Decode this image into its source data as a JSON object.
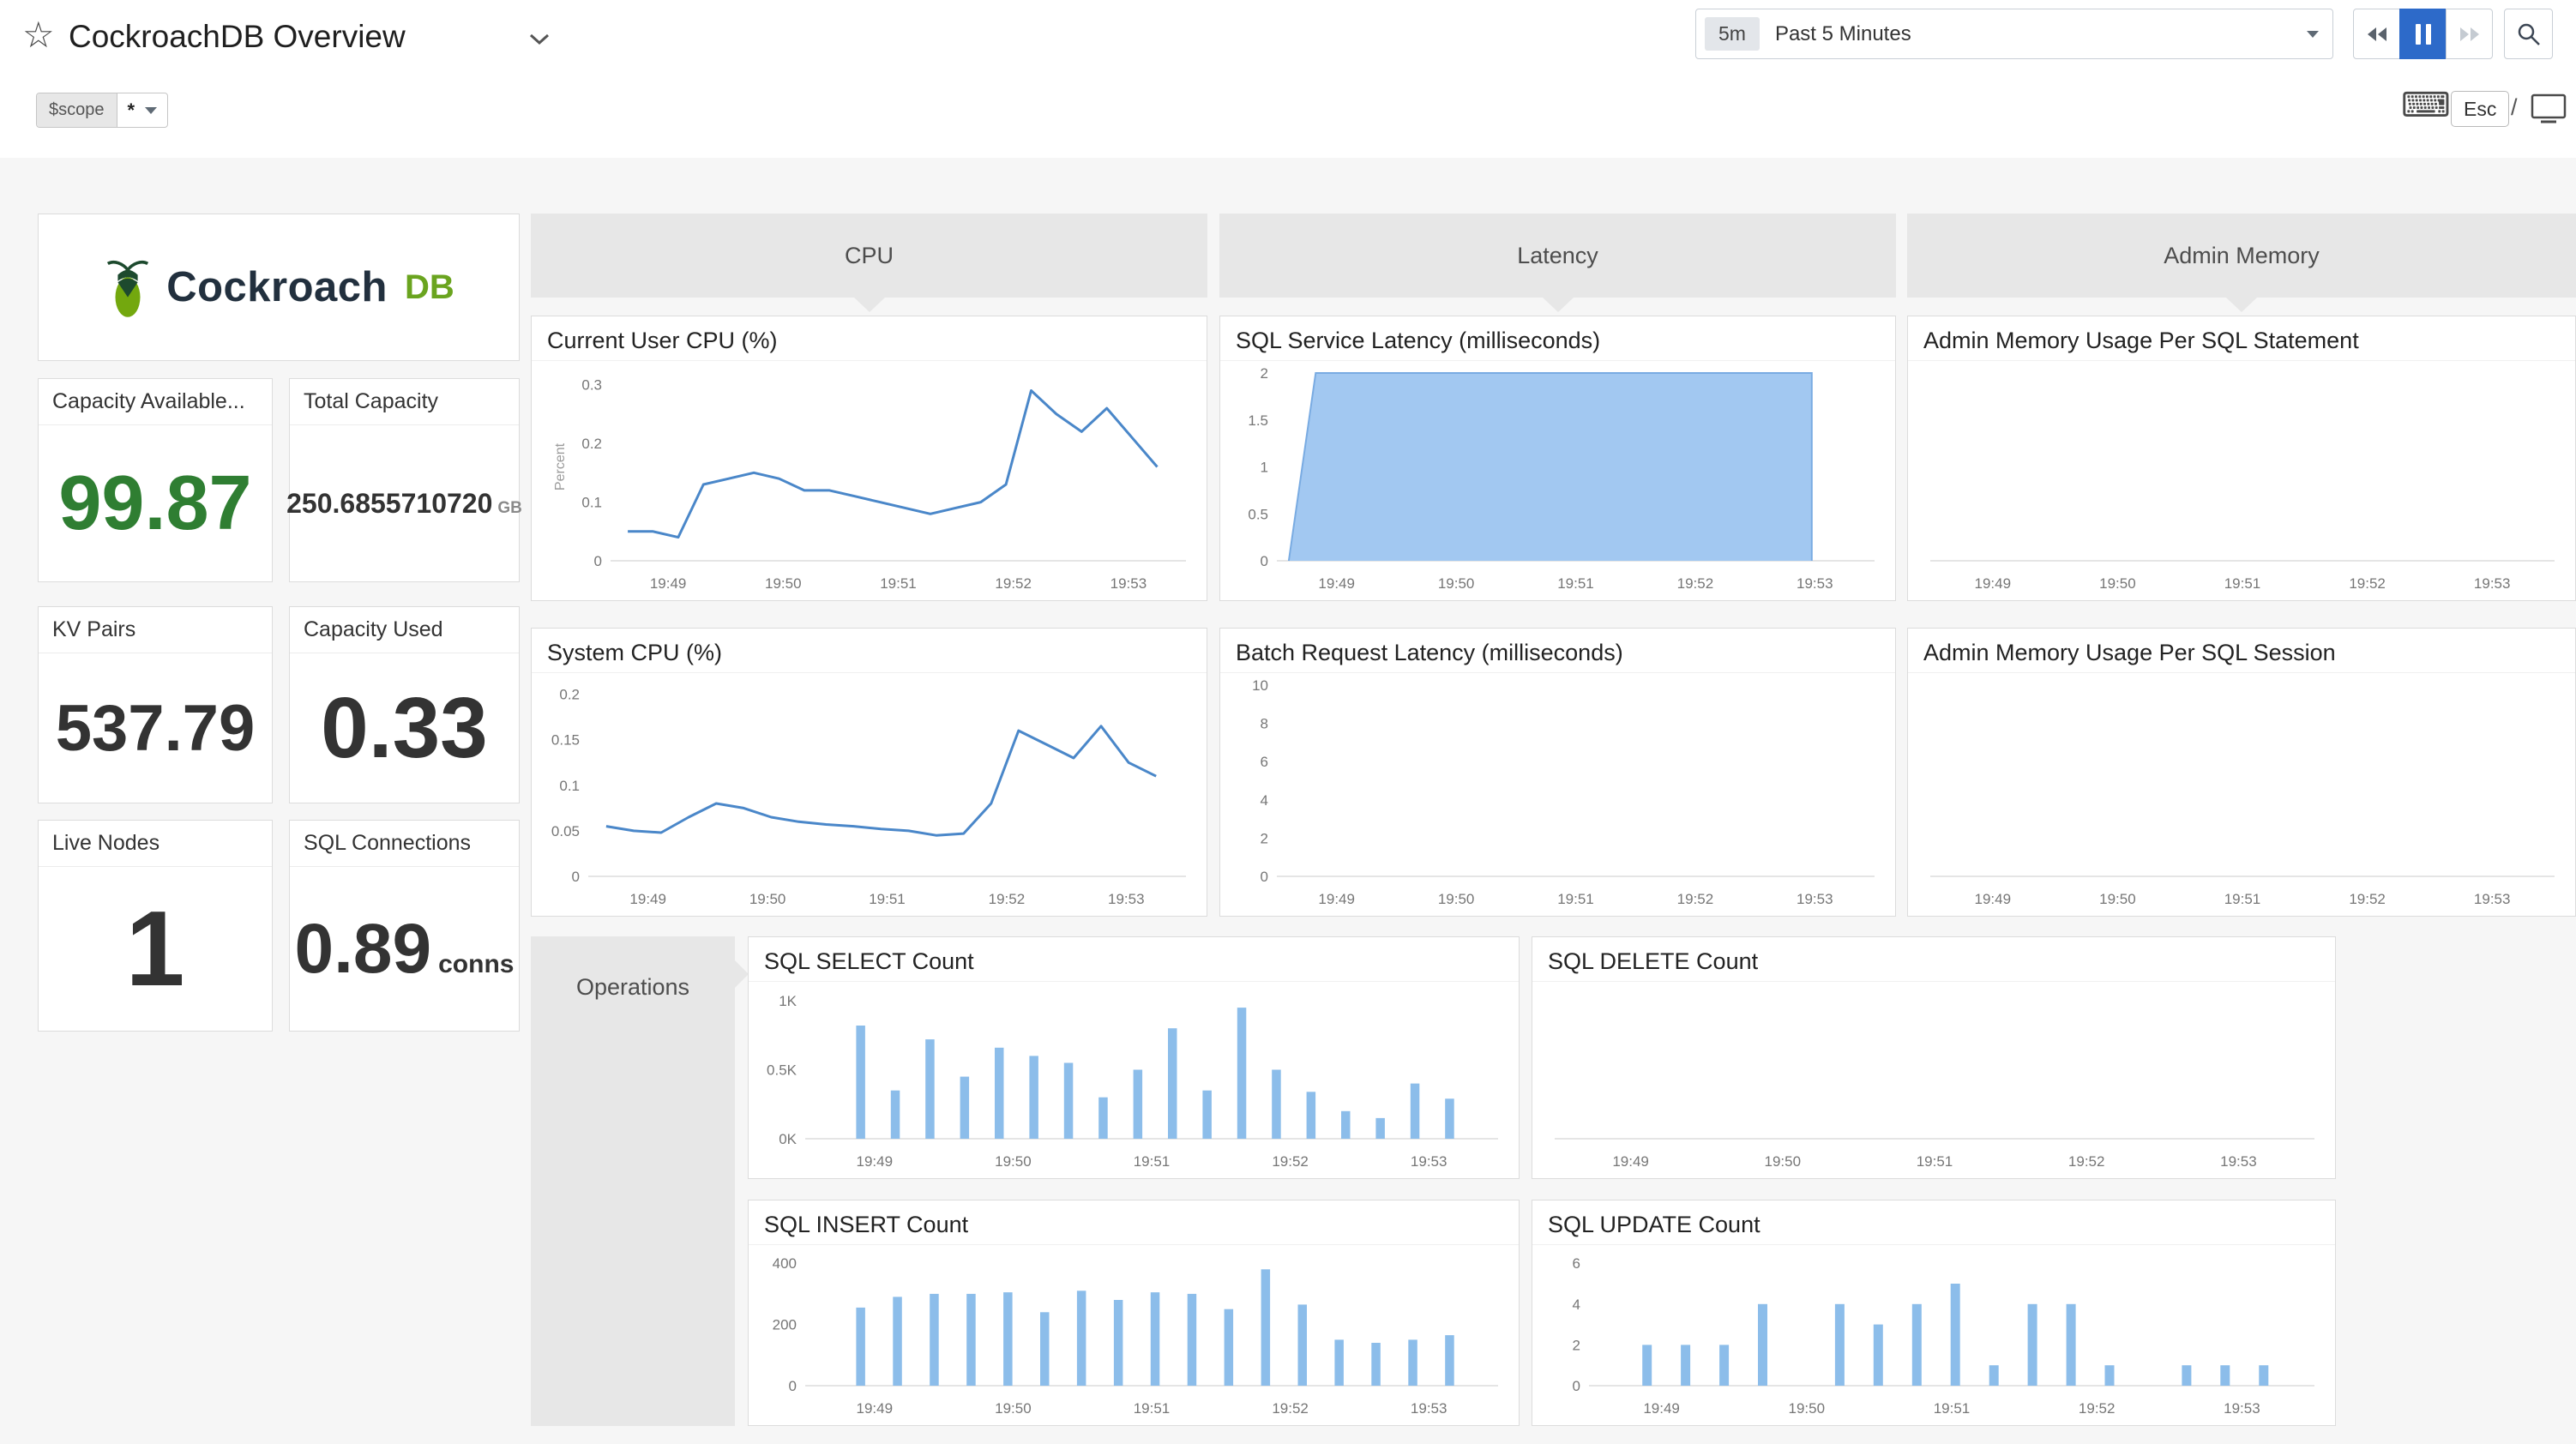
{
  "header": {
    "title": "CockroachDB Overview",
    "time_range": {
      "badge": "5m",
      "label": "Past 5 Minutes"
    },
    "shortcuts": {
      "esc": "Esc",
      "slash": "/"
    }
  },
  "icons": {
    "star": "☆",
    "keyboard": "⌨"
  },
  "scope_bar": {
    "variable": "$scope",
    "value": "*"
  },
  "logo": {
    "name": "Cockroach",
    "suffix": "DB"
  },
  "query_values": [
    {
      "title": "Capacity Available...",
      "value": "99.87",
      "unit": ""
    },
    {
      "title": "Total Capacity",
      "value": "250.6855710720",
      "unit": "GB"
    },
    {
      "title": "KV Pairs",
      "value": "537.79",
      "unit": ""
    },
    {
      "title": "Capacity Used",
      "value": "0.33",
      "unit": ""
    },
    {
      "title": "Live Nodes",
      "value": "1",
      "unit": ""
    },
    {
      "title": "SQL Connections",
      "value": "0.89",
      "unit": "conns"
    }
  ],
  "groups": [
    {
      "label": "CPU"
    },
    {
      "label": "Latency"
    },
    {
      "label": "Admin Memory"
    },
    {
      "label": "Operations"
    }
  ],
  "colors": {
    "accent_blue": "#2d6ac9",
    "line": "#4a87c9",
    "bar": "#8cbdea",
    "area_fill": "#a2c8f1",
    "area_stroke": "#79abe2",
    "value_green": "#2f7e32",
    "group_gray": "#e7e7e7"
  },
  "chart_data": [
    {
      "id": "current-user-cpu",
      "title": "Current User CPU (%)",
      "type": "line",
      "ylabel": "Percent",
      "ylim": [
        0,
        0.32
      ],
      "y_tick_values": [
        0,
        0.1,
        0.2,
        0.3
      ],
      "y_tick_labels": [
        "0",
        "0.1",
        "0.2",
        "0.3"
      ],
      "x_ticks": [
        "19:49",
        "19:50",
        "19:51",
        "19:52",
        "19:53"
      ],
      "values": [
        0.05,
        0.05,
        0.04,
        0.13,
        0.14,
        0.15,
        0.14,
        0.12,
        0.12,
        0.11,
        0.1,
        0.09,
        0.08,
        0.09,
        0.1,
        0.13,
        0.29,
        0.25,
        0.22,
        0.26,
        0.21,
        0.16
      ]
    },
    {
      "id": "system-cpu",
      "title": "System CPU (%)",
      "type": "line",
      "ylim": [
        0,
        0.21
      ],
      "y_tick_values": [
        0,
        0.05,
        0.1,
        0.15,
        0.2
      ],
      "y_tick_labels": [
        "0",
        "0.05",
        "0.1",
        "0.15",
        "0.2"
      ],
      "x_ticks": [
        "19:49",
        "19:50",
        "19:51",
        "19:52",
        "19:53"
      ],
      "values": [
        0.055,
        0.05,
        0.048,
        0.065,
        0.08,
        0.075,
        0.065,
        0.06,
        0.057,
        0.055,
        0.052,
        0.05,
        0.045,
        0.047,
        0.08,
        0.16,
        0.145,
        0.13,
        0.165,
        0.125,
        0.11
      ]
    },
    {
      "id": "sql-service-latency",
      "title": "SQL Service Latency (milliseconds)",
      "type": "area",
      "ylim": [
        0,
        2
      ],
      "y_tick_values": [
        0,
        0.5,
        1,
        1.5,
        2
      ],
      "y_tick_labels": [
        "0",
        "0.5",
        "1",
        "1.5",
        "2"
      ],
      "x_ticks": [
        "19:49",
        "19:50",
        "19:51",
        "19:52",
        "19:53"
      ],
      "points": [
        [
          0.02,
          0
        ],
        [
          0.065,
          2
        ],
        [
          0.895,
          2
        ]
      ]
    },
    {
      "id": "batch-request-latency",
      "title": "Batch Request Latency (milliseconds)",
      "type": "empty",
      "ylim": [
        0,
        10
      ],
      "y_tick_values": [
        0,
        2,
        4,
        6,
        8,
        10
      ],
      "y_tick_labels": [
        "0",
        "2",
        "4",
        "6",
        "8",
        "10"
      ],
      "x_ticks": [
        "19:49",
        "19:50",
        "19:51",
        "19:52",
        "19:53"
      ]
    },
    {
      "id": "admin-memory-per-statement",
      "title": "Admin Memory Usage Per SQL Statement",
      "type": "empty",
      "x_ticks": [
        "19:49",
        "19:50",
        "19:51",
        "19:52",
        "19:53"
      ]
    },
    {
      "id": "admin-memory-per-session",
      "title": "Admin Memory Usage Per SQL Session",
      "type": "empty",
      "x_ticks": [
        "19:49",
        "19:50",
        "19:51",
        "19:52",
        "19:53"
      ]
    },
    {
      "id": "sql-select-count",
      "title": "SQL SELECT Count",
      "type": "bar",
      "ylim": [
        0,
        1050
      ],
      "y_tick_values": [
        0,
        500,
        1000
      ],
      "y_tick_labels": [
        "0K",
        "0.5K",
        "1K"
      ],
      "x_ticks": [
        "19:49",
        "19:50",
        "19:51",
        "19:52",
        "19:53"
      ],
      "values": [
        820,
        350,
        720,
        450,
        660,
        600,
        550,
        300,
        500,
        800,
        350,
        950,
        500,
        340,
        200,
        150,
        400,
        290
      ]
    },
    {
      "id": "sql-delete-count",
      "title": "SQL DELETE Count",
      "type": "empty",
      "x_ticks": [
        "19:49",
        "19:50",
        "19:51",
        "19:52",
        "19:53"
      ]
    },
    {
      "id": "sql-insert-count",
      "title": "SQL INSERT Count",
      "type": "bar",
      "ylim": [
        0,
        420
      ],
      "y_tick_values": [
        0,
        200,
        400
      ],
      "y_tick_labels": [
        "0",
        "200",
        "400"
      ],
      "x_ticks": [
        "19:49",
        "19:50",
        "19:51",
        "19:52",
        "19:53"
      ],
      "values": [
        255,
        290,
        300,
        300,
        305,
        240,
        310,
        280,
        305,
        300,
        250,
        380,
        265,
        150,
        140,
        150,
        165
      ]
    },
    {
      "id": "sql-update-count",
      "title": "SQL UPDATE Count",
      "type": "bar",
      "ylim": [
        0,
        6.3
      ],
      "y_tick_values": [
        0,
        2,
        4,
        6
      ],
      "y_tick_labels": [
        "0",
        "2",
        "4",
        "6"
      ],
      "x_ticks": [
        "19:49",
        "19:50",
        "19:51",
        "19:52",
        "19:53"
      ],
      "values": [
        2,
        2,
        2,
        4,
        0,
        4,
        3,
        4,
        5,
        1,
        4,
        4,
        1,
        0,
        1,
        1,
        1
      ]
    }
  ]
}
